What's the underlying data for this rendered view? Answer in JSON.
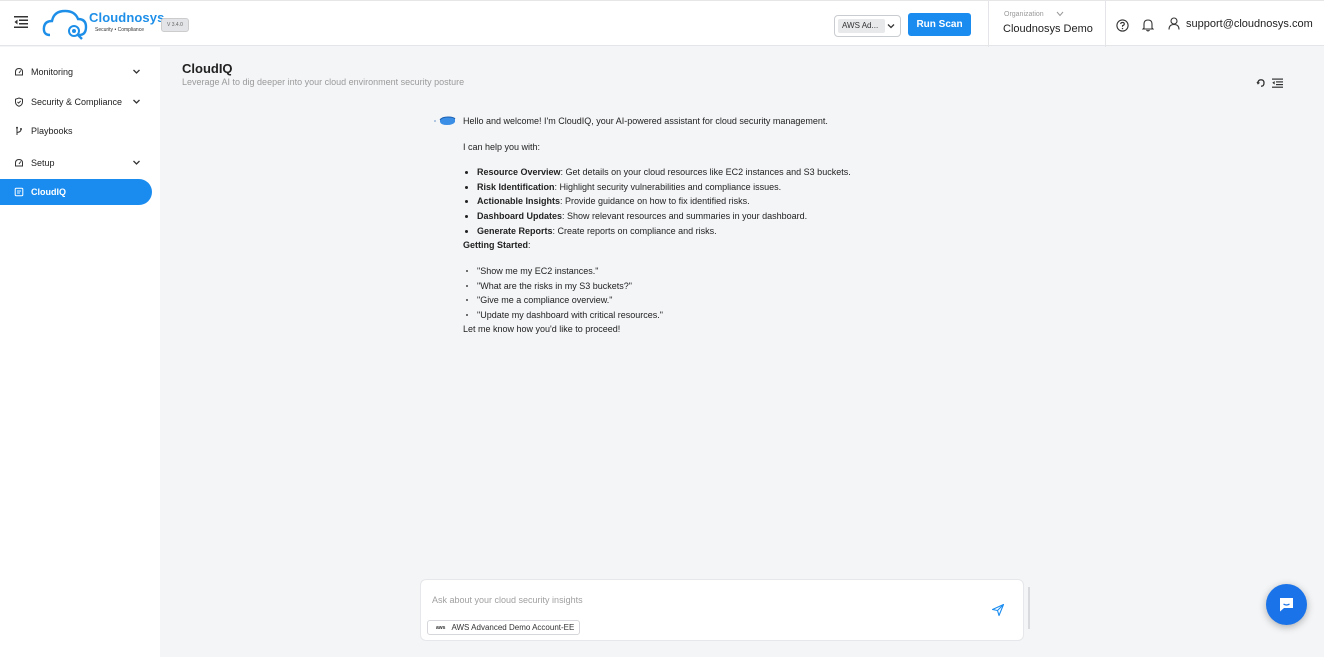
{
  "header": {
    "brand": "Cloudnosys",
    "brand_tag": "Security • Compliance",
    "version": "V 3.4.0",
    "account_selected": "AWS Ad...",
    "run_scan_label": "Run Scan",
    "org_label": "Organization",
    "org_name": "Cloudnosys Demo",
    "user_email": "support@cloudnosys.com"
  },
  "sidebar": {
    "items": [
      {
        "label": "Monitoring",
        "icon": "gauge-icon",
        "has_children": true
      },
      {
        "label": "Security & Compliance",
        "icon": "shield-icon",
        "has_children": true
      },
      {
        "label": "Playbooks",
        "icon": "branch-icon",
        "has_children": false
      },
      {
        "label": "Setup",
        "icon": "gauge-icon",
        "has_children": true
      },
      {
        "label": "CloudIQ",
        "icon": "chat-box-icon",
        "has_children": false,
        "active": true
      }
    ]
  },
  "page": {
    "title": "CloudIQ",
    "subtitle": "Leverage AI to dig deeper into your cloud environment security posture"
  },
  "chat": {
    "greeting": "Hello and welcome! I'm CloudIQ, your AI-powered assistant for cloud security management.",
    "help_intro": "I can help you with:",
    "capabilities": [
      {
        "title": "Resource Overview",
        "text": ": Get details on your cloud resources like EC2 instances and S3 buckets."
      },
      {
        "title": "Risk Identification",
        "text": ": Highlight security vulnerabilities and compliance issues."
      },
      {
        "title": "Actionable Insights",
        "text": ": Provide guidance on how to fix identified risks."
      },
      {
        "title": "Dashboard Updates",
        "text": ": Show relevant resources and summaries in your dashboard."
      },
      {
        "title": "Generate Reports",
        "text": ": Create reports on compliance and risks."
      }
    ],
    "getting_started_title": "Getting Started",
    "getting_started_colon": ":",
    "examples": [
      "\"Show me my EC2 instances.\"",
      "\"What are the risks in my S3 buckets?\"",
      "\"Give me a compliance overview.\"",
      "\"Update my dashboard with critical resources.\""
    ],
    "closing": "Let me know how you'd like to proceed!"
  },
  "composer": {
    "placeholder": "Ask about your cloud security insights",
    "chip_provider": "aws",
    "chip_label": "AWS Advanced Demo Account-EE"
  },
  "colors": {
    "accent": "#1a8cf0",
    "fab": "#1a73e8",
    "brand": "#1e8fe8"
  }
}
